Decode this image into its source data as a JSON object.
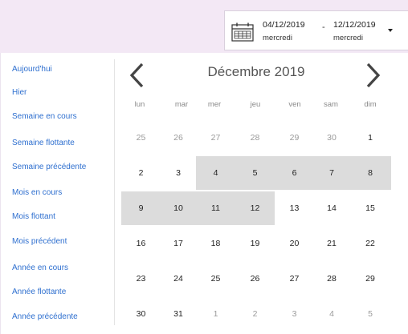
{
  "range": {
    "start_date": "04/12/2019",
    "start_day": "mercredi",
    "separator": "-",
    "end_date": "12/12/2019",
    "end_day": "mercredi"
  },
  "sidebar": {
    "items": [
      {
        "label": "Aujourd'hui"
      },
      {
        "label": "Hier"
      },
      {
        "label": "Semaine en cours"
      },
      {
        "label": "Semaine flottante"
      },
      {
        "label": "Semaine précédente"
      },
      {
        "label": "Mois en cours"
      },
      {
        "label": "Mois flottant"
      },
      {
        "label": "Mois précédent"
      },
      {
        "label": "Année en cours"
      },
      {
        "label": "Année flottante"
      },
      {
        "label": "Année précédente"
      }
    ]
  },
  "calendar": {
    "month_title": "Décembre 2019",
    "weekdays": [
      "lun",
      "mar",
      "mer",
      "jeu",
      "ven",
      "sam",
      "dim"
    ],
    "weeks": [
      [
        {
          "d": "25",
          "o": 1
        },
        {
          "d": "26",
          "o": 1
        },
        {
          "d": "27",
          "o": 1
        },
        {
          "d": "28",
          "o": 1
        },
        {
          "d": "29",
          "o": 1
        },
        {
          "d": "30",
          "o": 1
        },
        {
          "d": "1",
          "o": 0
        }
      ],
      [
        {
          "d": "2",
          "o": 0
        },
        {
          "d": "3",
          "o": 0
        },
        {
          "d": "4",
          "o": 0,
          "s": 1
        },
        {
          "d": "5",
          "o": 0,
          "s": 1
        },
        {
          "d": "6",
          "o": 0,
          "s": 1
        },
        {
          "d": "7",
          "o": 0,
          "s": 1
        },
        {
          "d": "8",
          "o": 0,
          "s": 1
        }
      ],
      [
        {
          "d": "9",
          "o": 0,
          "s": 1
        },
        {
          "d": "10",
          "o": 0,
          "s": 1
        },
        {
          "d": "11",
          "o": 0,
          "s": 1
        },
        {
          "d": "12",
          "o": 0,
          "s": 1
        },
        {
          "d": "13",
          "o": 0
        },
        {
          "d": "14",
          "o": 0
        },
        {
          "d": "15",
          "o": 0
        }
      ],
      [
        {
          "d": "16",
          "o": 0
        },
        {
          "d": "17",
          "o": 0
        },
        {
          "d": "18",
          "o": 0
        },
        {
          "d": "19",
          "o": 0
        },
        {
          "d": "20",
          "o": 0
        },
        {
          "d": "21",
          "o": 0
        },
        {
          "d": "22",
          "o": 0
        }
      ],
      [
        {
          "d": "23",
          "o": 0
        },
        {
          "d": "24",
          "o": 0
        },
        {
          "d": "25",
          "o": 0
        },
        {
          "d": "26",
          "o": 0
        },
        {
          "d": "27",
          "o": 0
        },
        {
          "d": "28",
          "o": 0
        },
        {
          "d": "29",
          "o": 0
        }
      ],
      [
        {
          "d": "30",
          "o": 0
        },
        {
          "d": "31",
          "o": 0
        },
        {
          "d": "1",
          "o": 1
        },
        {
          "d": "2",
          "o": 1
        },
        {
          "d": "3",
          "o": 1
        },
        {
          "d": "4",
          "o": 1
        },
        {
          "d": "5",
          "o": 1
        }
      ]
    ]
  },
  "icons": {
    "calendar": "calendar-icon",
    "prev": "chevron-left-icon",
    "next": "chevron-right-icon",
    "dropdown": "caret-down-icon"
  },
  "colors": {
    "background": "#f3e8f5",
    "link": "#2e6fcf",
    "selected": "#dcdcdc"
  }
}
